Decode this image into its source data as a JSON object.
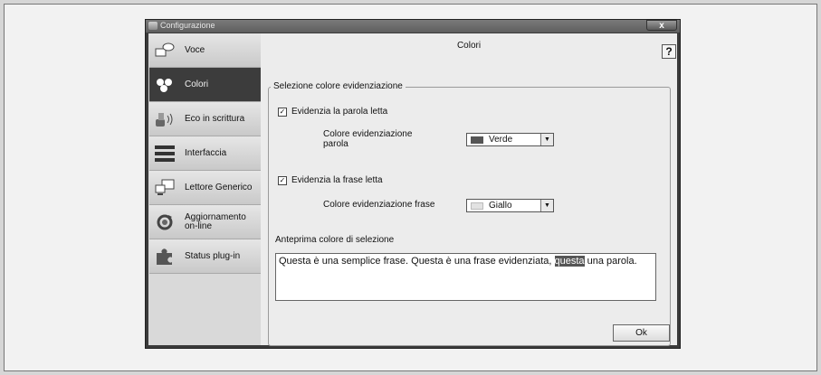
{
  "window": {
    "title": "Configurazione",
    "close_label": "x"
  },
  "sidebar": {
    "items": [
      {
        "label": "Voce",
        "icon": "speech-bubble-icon",
        "active": false
      },
      {
        "label": "Colori",
        "icon": "color-dots-icon",
        "active": true
      },
      {
        "label": "Eco in scrittura",
        "icon": "typing-echo-icon",
        "active": false
      },
      {
        "label": "Interfaccia",
        "icon": "interface-bars-icon",
        "active": false
      },
      {
        "label": "Lettore Generico",
        "icon": "monitor-icon",
        "active": false
      },
      {
        "label": "Aggiornamento on-line",
        "icon": "refresh-icon",
        "active": false
      },
      {
        "label": "Status plug-in",
        "icon": "puzzle-icon",
        "active": false
      }
    ]
  },
  "content": {
    "title": "Colori",
    "help_label": "?",
    "group_title": "Selezione colore evidenziazione",
    "word_check": {
      "label": "Evidenzia la parola letta",
      "checked": true,
      "mark": "✓"
    },
    "word_color": {
      "label": "Colore evidenziazione parola",
      "value": "Verde",
      "swatch": "#555555"
    },
    "sentence_check": {
      "label": "Evidenzia la frase letta",
      "checked": true,
      "mark": "✓"
    },
    "sentence_color": {
      "label": "Colore evidenziazione frase",
      "value": "Giallo",
      "swatch": "#e2e2e2"
    },
    "preview_label": "Anteprima colore di selezione",
    "preview": {
      "before": "Questa è una semplice frase. Questa è una frase evidenziata, ",
      "highlight": "questa",
      "after": " una parola."
    },
    "ok_label": "Ok"
  }
}
